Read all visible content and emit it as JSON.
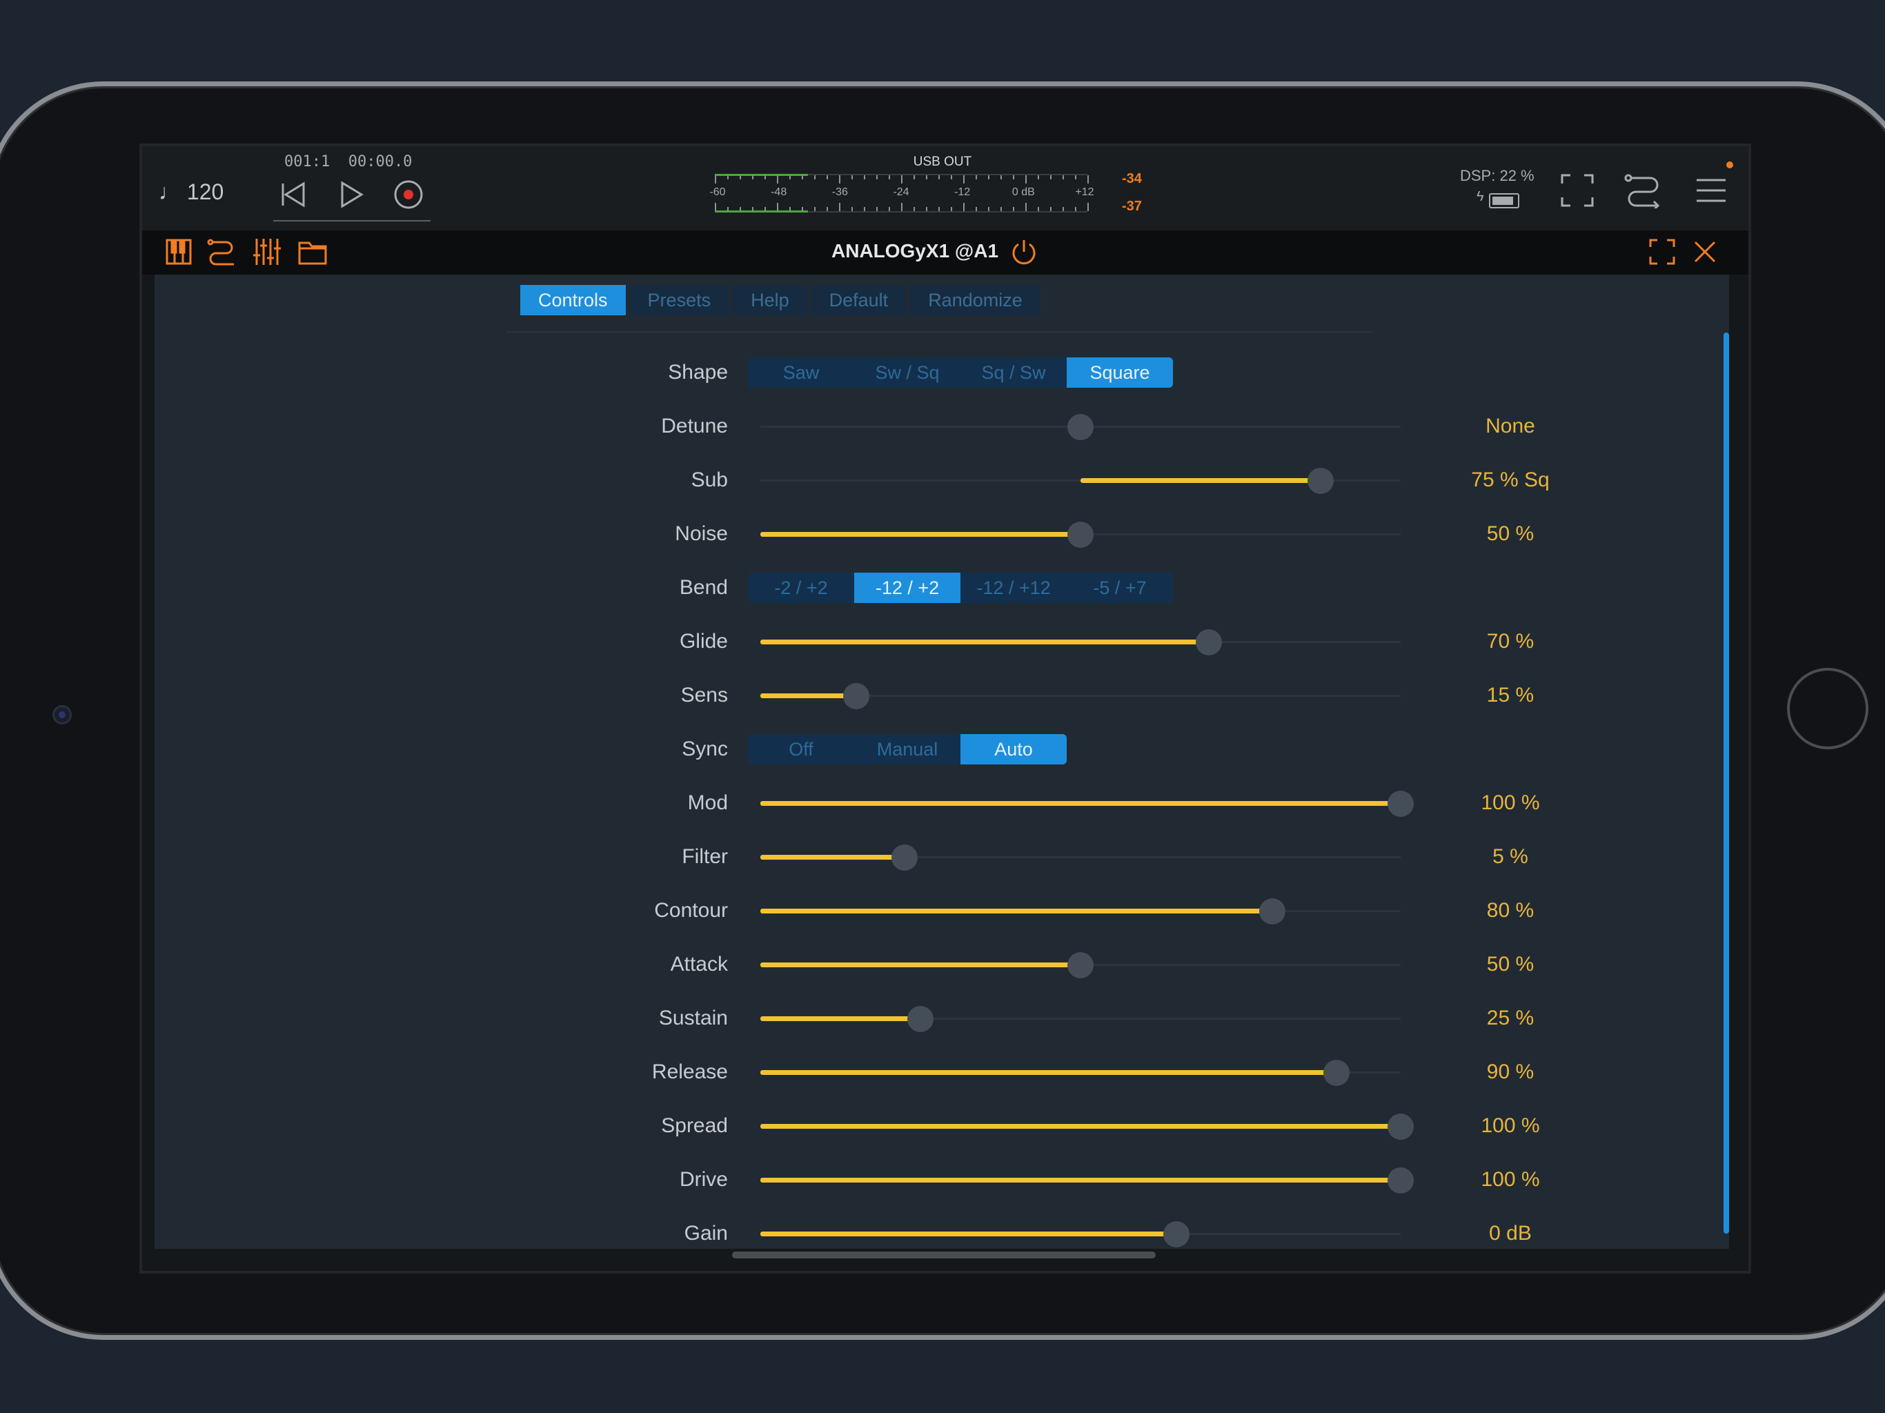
{
  "transport": {
    "tempo": "♩ 120",
    "position": "001:1  00:00.0",
    "rewind_icon": "skip-back-icon",
    "play_icon": "play-icon",
    "record_icon": "record-icon"
  },
  "meter": {
    "title": "USB OUT",
    "ticks": [
      "-60",
      "-48",
      "-36",
      "-24",
      "-12",
      "0 dB",
      "+12"
    ],
    "peak_left": "-34",
    "peak_right": "-37",
    "level": 0.25
  },
  "status": {
    "dsp": "DSP: 22 %",
    "battery_icon": "battery-icon"
  },
  "plugin": {
    "title": "ANALOGyX1 @A1",
    "power_icon": "power-icon"
  },
  "tabs": [
    {
      "label": "Controls",
      "active": true
    },
    {
      "label": "Presets",
      "active": false
    },
    {
      "label": "Help",
      "active": false
    },
    {
      "label": "Default",
      "active": false
    },
    {
      "label": "Randomize",
      "active": false
    }
  ],
  "controls": {
    "shape": {
      "label": "Shape",
      "options": [
        "Saw",
        "Sw / Sq",
        "Sq / Sw",
        "Square"
      ],
      "selected": 3
    },
    "detune": {
      "label": "Detune",
      "value": "None",
      "level": 0.5
    },
    "sub": {
      "label": "Sub",
      "value": "75 % Sq",
      "level": 0.875
    },
    "noise": {
      "label": "Noise",
      "value": "50 %",
      "level": 0.5
    },
    "bend": {
      "label": "Bend",
      "options": [
        "-2 / +2",
        "-12 / +2",
        "-12 / +12",
        "-5 / +7"
      ],
      "selected": 1
    },
    "glide": {
      "label": "Glide",
      "value": "70 %",
      "level": 0.7
    },
    "sens": {
      "label": "Sens",
      "value": "15 %",
      "level": 0.15
    },
    "sync": {
      "label": "Sync",
      "options": [
        "Off",
        "Manual",
        "Auto"
      ],
      "selected": 2
    },
    "mod": {
      "label": "Mod",
      "value": "100 %",
      "level": 1.0
    },
    "filter": {
      "label": "Filter",
      "value": "5 %",
      "level": 0.225
    },
    "contour": {
      "label": "Contour",
      "value": "80 %",
      "level": 0.8
    },
    "attack": {
      "label": "Attack",
      "value": "50 %",
      "level": 0.5
    },
    "sustain": {
      "label": "Sustain",
      "value": "25 %",
      "level": 0.25
    },
    "release": {
      "label": "Release",
      "value": "90 %",
      "level": 0.9
    },
    "spread": {
      "label": "Spread",
      "value": "100 %",
      "level": 1.0
    },
    "drive": {
      "label": "Drive",
      "value": "100 %",
      "level": 1.0
    },
    "gain": {
      "label": "Gain",
      "value": "0 dB",
      "level": 0.65
    }
  },
  "colors": {
    "accent": "#1e8fdc",
    "slider_fill": "#f3c331",
    "value_text": "#e8b53b",
    "toolbar_icons": "#ef7d22"
  }
}
